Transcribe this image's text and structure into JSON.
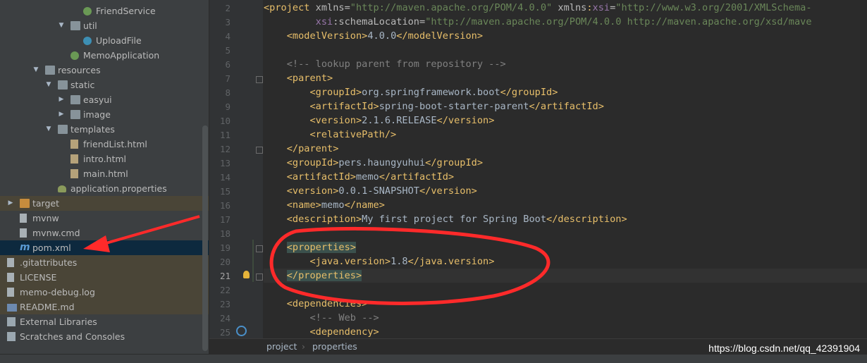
{
  "tree": {
    "items": [
      {
        "label": "FriendService",
        "icon": "spring-class-icon",
        "indent": 1
      },
      {
        "label": "util",
        "icon": "folder-icon",
        "expanded": true
      },
      {
        "label": "UploadFile",
        "icon": "class-icon"
      },
      {
        "label": "MemoApplication",
        "icon": "spring-class-icon"
      },
      {
        "label": "resources",
        "icon": "resources-folder-icon",
        "expanded": true
      },
      {
        "label": "static",
        "icon": "folder-icon",
        "expanded": true
      },
      {
        "label": "easyui",
        "icon": "folder-icon",
        "expanded": false
      },
      {
        "label": "image",
        "icon": "folder-icon",
        "expanded": false
      },
      {
        "label": "templates",
        "icon": "folder-icon",
        "expanded": true
      },
      {
        "label": "friendList.html",
        "icon": "html-file-icon"
      },
      {
        "label": "intro.html",
        "icon": "html-file-icon"
      },
      {
        "label": "main.html",
        "icon": "html-file-icon"
      },
      {
        "label": "application.properties",
        "icon": "properties-file-icon"
      },
      {
        "label": "target",
        "icon": "excluded-folder-icon",
        "expanded": false
      },
      {
        "label": "mvnw",
        "icon": "file-icon"
      },
      {
        "label": "mvnw.cmd",
        "icon": "file-icon"
      },
      {
        "label": "pom.xml",
        "icon": "maven-icon",
        "selected": true
      },
      {
        "label": ".gitattributes",
        "icon": "file-icon"
      },
      {
        "label": "LICENSE",
        "icon": "file-icon"
      },
      {
        "label": "memo-debug.log",
        "icon": "file-icon"
      },
      {
        "label": "README.md",
        "icon": "markdown-icon"
      },
      {
        "label": "External Libraries",
        "icon": "library-icon"
      },
      {
        "label": "Scratches and Consoles",
        "icon": "scratches-icon"
      }
    ]
  },
  "editor": {
    "line_numbers": [
      "2",
      "3",
      "4",
      "5",
      "6",
      "7",
      "8",
      "9",
      "10",
      "11",
      "12",
      "13",
      "14",
      "15",
      "16",
      "17",
      "18",
      "19",
      "20",
      "21",
      "22",
      "23",
      "24",
      "25"
    ],
    "current_line": "21",
    "lines": [
      [
        [
          "tg",
          "<project "
        ],
        [
          "an",
          "xmlns="
        ],
        [
          "av",
          "\"http://maven.apache.org/POM/4.0.0\""
        ],
        [
          "an",
          " xmlns"
        ],
        [
          "tg",
          ":"
        ],
        [
          "ns",
          "xsi"
        ],
        [
          "an",
          "="
        ],
        [
          "av",
          "\"http://www.w3.org/2001/XMLSchema-"
        ]
      ],
      [
        [
          "an",
          "         "
        ],
        [
          "ns",
          "xsi"
        ],
        [
          "an",
          ":schemaLocation="
        ],
        [
          "av",
          "\"http://maven.apache.org/POM/4.0.0 http://maven.apache.org/xsd/mave"
        ]
      ],
      [
        [
          "tg",
          "    <modelVersion>"
        ],
        [
          "tx",
          "4.0.0"
        ],
        [
          "tg",
          "</modelVersion>"
        ]
      ],
      [
        [
          "tx",
          ""
        ]
      ],
      [
        [
          "cm",
          "    <!-- lookup parent from repository -->"
        ]
      ],
      [
        [
          "tg",
          "    <parent>"
        ]
      ],
      [
        [
          "tg",
          "        <groupId>"
        ],
        [
          "tx",
          "org.springframework.boot"
        ],
        [
          "tg",
          "</groupId>"
        ]
      ],
      [
        [
          "tg",
          "        <artifactId>"
        ],
        [
          "tx",
          "spring-boot-starter-parent"
        ],
        [
          "tg",
          "</artifactId>"
        ]
      ],
      [
        [
          "tg",
          "        <version>"
        ],
        [
          "tx",
          "2.1.6.RELEASE"
        ],
        [
          "tg",
          "</version>"
        ]
      ],
      [
        [
          "tg",
          "        <relativePath/>"
        ]
      ],
      [
        [
          "tg",
          "    </parent>"
        ]
      ],
      [
        [
          "tg",
          "    <groupId>"
        ],
        [
          "tx",
          "pers.haungyuhui"
        ],
        [
          "tg",
          "</groupId>"
        ]
      ],
      [
        [
          "tg",
          "    <artifactId>"
        ],
        [
          "tx",
          "memo"
        ],
        [
          "tg",
          "</artifactId>"
        ]
      ],
      [
        [
          "tg",
          "    <version>"
        ],
        [
          "tx",
          "0.0.1-SNAPSHOT"
        ],
        [
          "tg",
          "</version>"
        ]
      ],
      [
        [
          "tg",
          "    <name>"
        ],
        [
          "tx",
          "memo"
        ],
        [
          "tg",
          "</name>"
        ]
      ],
      [
        [
          "tg",
          "    <description>"
        ],
        [
          "tx",
          "My first project for Spring Boot"
        ],
        [
          "tg",
          "</description>"
        ]
      ],
      [
        [
          "tx",
          ""
        ]
      ],
      [
        [
          "tx",
          "    "
        ],
        [
          "tg hl",
          "<properties>"
        ]
      ],
      [
        [
          "tg",
          "        <java.version>"
        ],
        [
          "tx",
          "1.8"
        ],
        [
          "tg",
          "</java.version>"
        ]
      ],
      [
        [
          "tx",
          "    "
        ],
        [
          "tg hl",
          "</properties>"
        ]
      ],
      [
        [
          "tx",
          ""
        ]
      ],
      [
        [
          "tg",
          "    <dependencies>"
        ]
      ],
      [
        [
          "cm",
          "        <!-- Web -->"
        ]
      ],
      [
        [
          "tg",
          "        <dependency>"
        ]
      ]
    ]
  },
  "breadcrumb": [
    "project",
    "properties"
  ],
  "watermark": "https://blog.csdn.net/qq_42391904",
  "colors": {
    "annotation": "#ff2a2a"
  }
}
